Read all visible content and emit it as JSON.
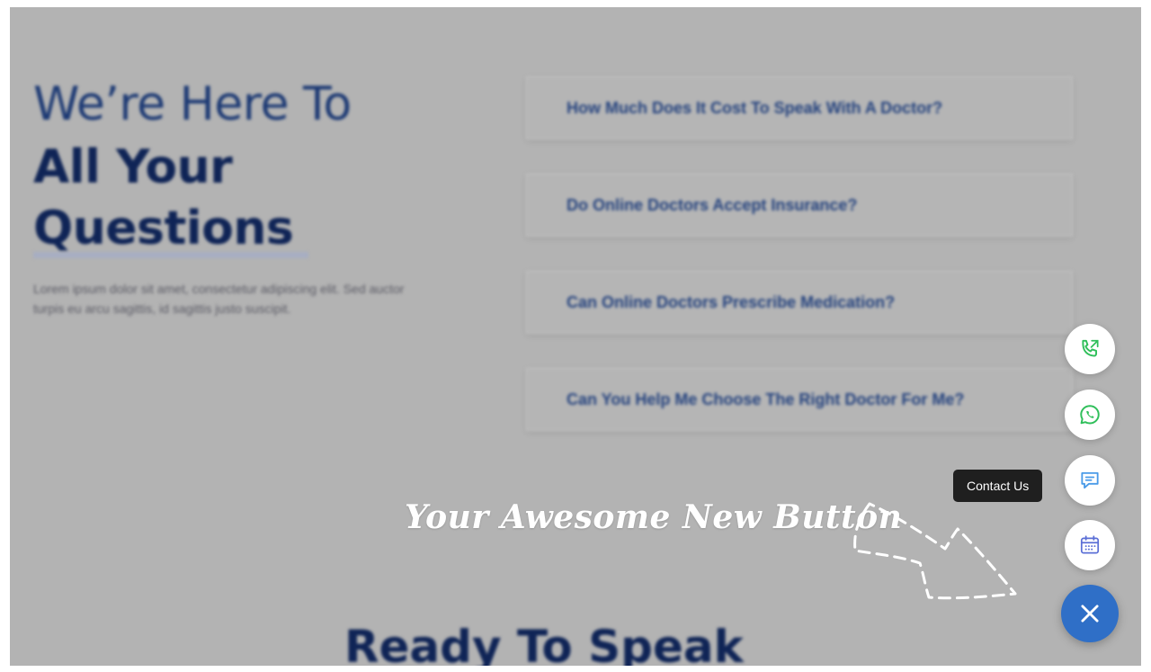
{
  "hero": {
    "line1": "We’re Here To",
    "line2": "All Your",
    "line3": "Questions",
    "description": "Lorem ipsum dolor sit amet, consectetur adipiscing elit. Sed auctor turpis eu arcu sagittis, id sagittis justo suscipit."
  },
  "faq": [
    {
      "question": "How Much Does It Cost To Speak With A Doctor?"
    },
    {
      "question": "Do Online Doctors Accept Insurance?"
    },
    {
      "question": "Can Online Doctors Prescribe Medication?"
    },
    {
      "question": "Can You Help Me Choose The Right Doctor For Me?"
    }
  ],
  "bottom": {
    "heading": "Ready To Speak"
  },
  "annotation": {
    "text": "Your Awesome New Button"
  },
  "contact_widget": {
    "tooltip": "Contact Us",
    "buttons": [
      {
        "icon": "phone-icon",
        "color": "#2fbf5a"
      },
      {
        "icon": "whatsapp-icon",
        "color": "#2fbf5a"
      },
      {
        "icon": "chat-icon",
        "color": "#4a9be8"
      },
      {
        "icon": "calendar-icon",
        "color": "#5b6fd6"
      }
    ],
    "close_icon": "close-icon",
    "accent": "#2f6fc7"
  }
}
